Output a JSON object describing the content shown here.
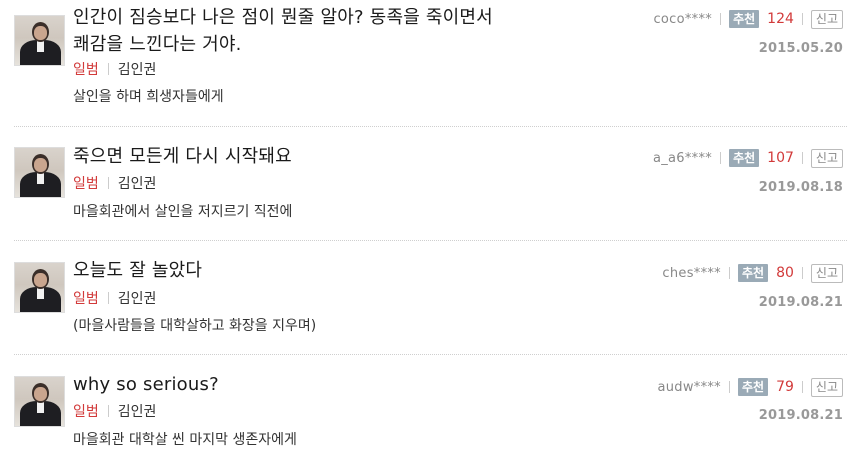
{
  "recommend_label": "추천",
  "report_label": "신고",
  "items": [
    {
      "quote": "인간이 짐승보다 나은 점이 뭔줄 알아? 동족을 죽이면서 쾌감을 느낀다는 거야.",
      "work": "일범",
      "person": "김인권",
      "context": "살인을 하며 희생자들에게",
      "user": "coco****",
      "recommend_count": "124",
      "date": "2015.05.20"
    },
    {
      "quote": "죽으면 모든게 다시 시작돼요",
      "work": "일범",
      "person": "김인권",
      "context": "마을회관에서 살인을 저지르기 직전에",
      "user": "a_a6****",
      "recommend_count": "107",
      "date": "2019.08.18"
    },
    {
      "quote": "오늘도 잘 놀았다",
      "work": "일범",
      "person": "김인권",
      "context": "(마을사람들을 대학살하고 화장을 지우며)",
      "user": "ches****",
      "recommend_count": "80",
      "date": "2019.08.21"
    },
    {
      "quote": "why so serious?",
      "work": "일범",
      "person": "김인권",
      "context": "마을회관 대학살 씬 마지막 생존자에게",
      "user": "audw****",
      "recommend_count": "79",
      "date": "2019.08.21"
    }
  ]
}
